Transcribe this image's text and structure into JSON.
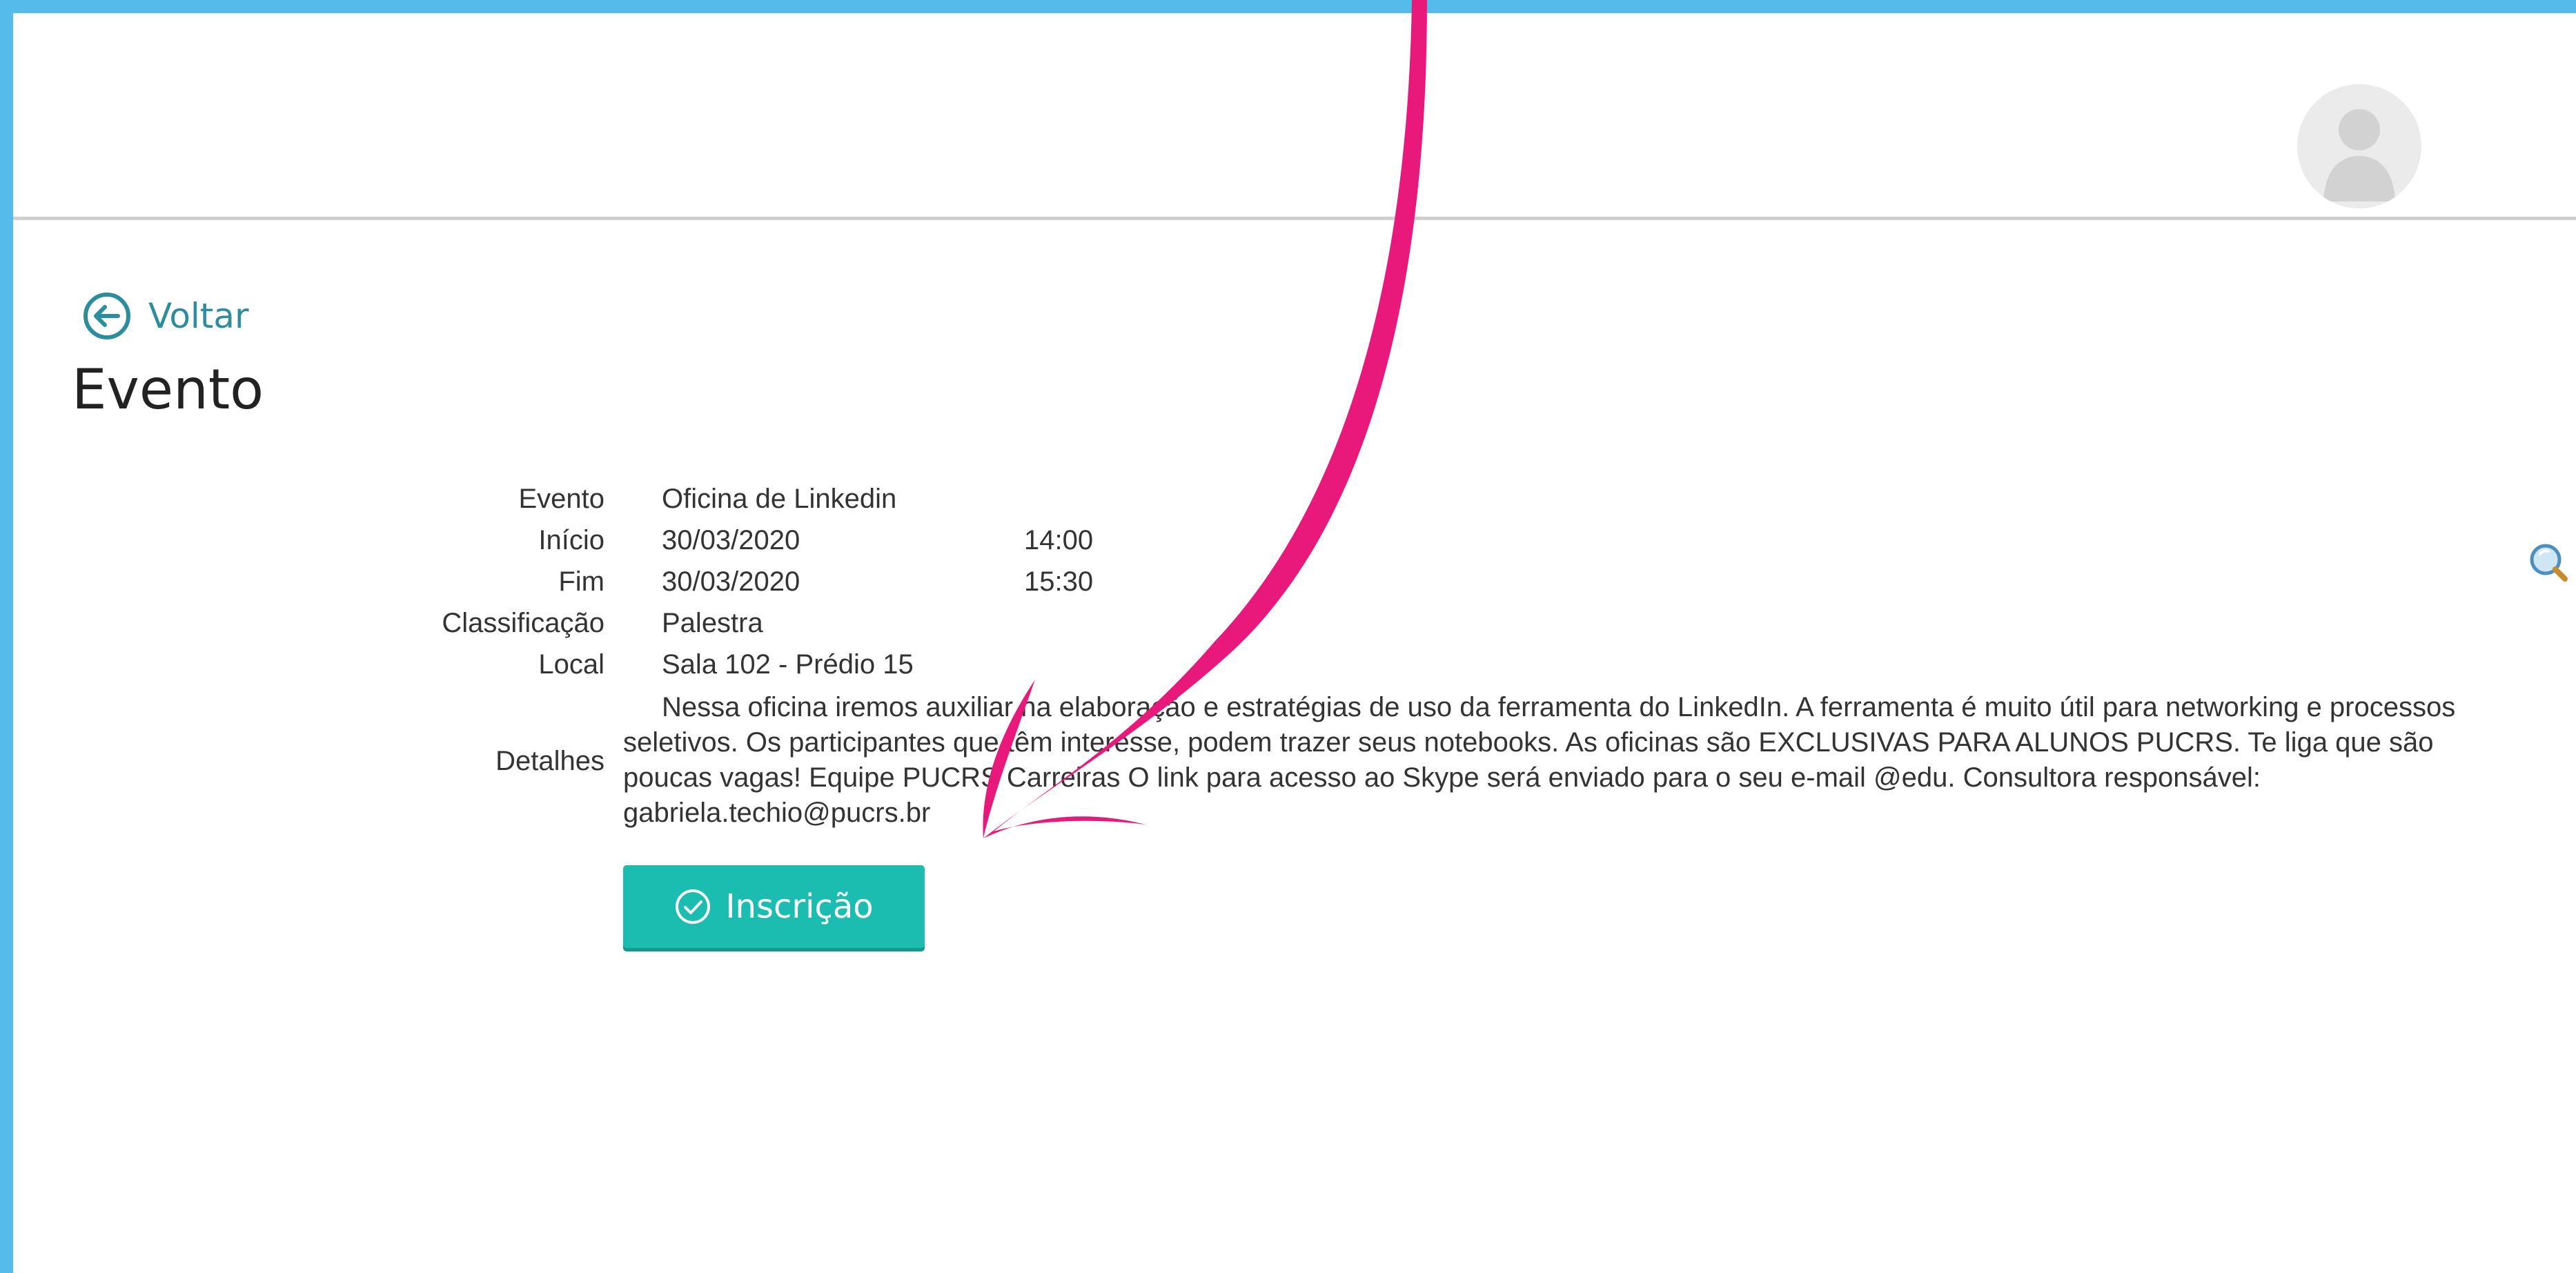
{
  "page": {
    "frame_color": "#55bbea",
    "accent_color": "#1bbdb1",
    "link_color": "#2b8d9e",
    "annotation_color": "#e8197a"
  },
  "header": {
    "avatar_icon": "user-avatar-icon"
  },
  "navigation": {
    "back_label": "Voltar",
    "back_icon": "arrow-left-circle-icon"
  },
  "title": "Evento",
  "event": {
    "rows": [
      {
        "label": "Evento",
        "value": "Oficina de Linkedin"
      },
      {
        "label": "Início",
        "value": "30/03/2020",
        "time": "14:00"
      },
      {
        "label": "Fim",
        "value": "30/03/2020",
        "time": "15:30"
      },
      {
        "label": "Classificação",
        "value": "Palestra"
      },
      {
        "label": "Local",
        "value": "Sala 102 - Prédio 15"
      }
    ],
    "details_label": "Detalhes",
    "details_text": "Nessa oficina iremos auxiliar na elaboração e estratégias de uso da ferramenta do LinkedIn. A ferramenta é muito útil para networking e processos seletivos. Os participantes que têm interesse, podem trazer seus notebooks. As oficinas são EXCLUSIVAS PARA ALUNOS PUCRS. Te liga que são poucas vagas! Equipe PUCRS Carreiras O link para acesso ao Skype será enviado para o seu e-mail @edu. Consultora responsável: gabriela.techio@pucrs.br"
  },
  "actions": {
    "subscribe_label": "Inscrição",
    "subscribe_icon": "check-circle-icon"
  },
  "side_icon": "magnifier-icon"
}
